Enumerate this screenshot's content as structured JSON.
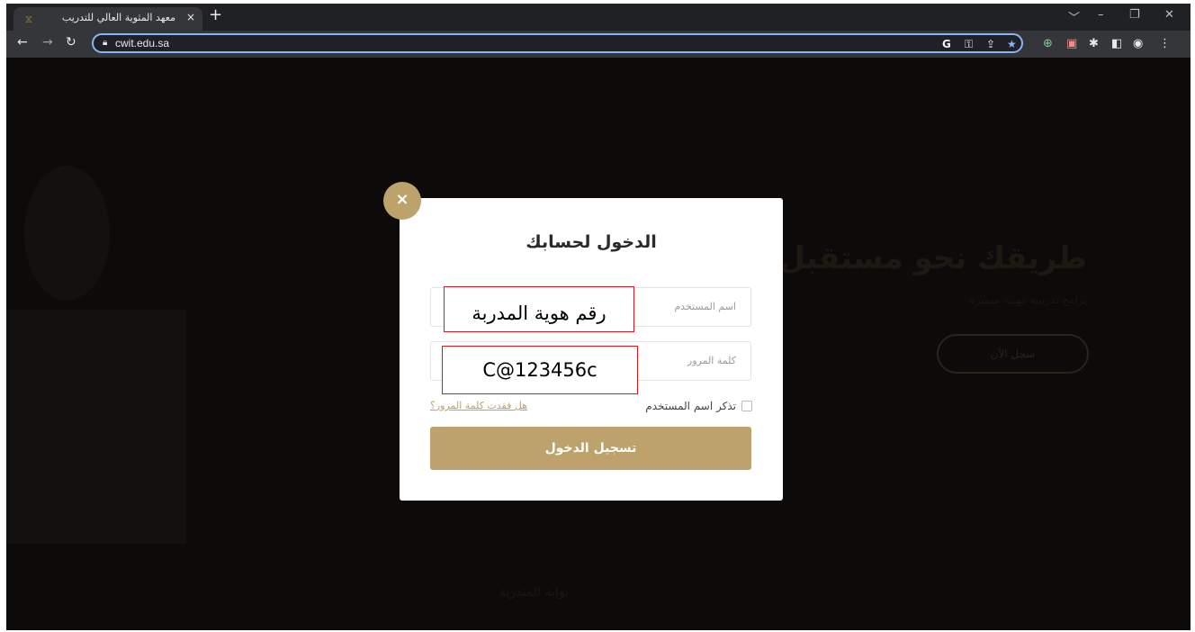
{
  "browser": {
    "tab_title": "معهد المثوية العالي للتدريب",
    "tab_close": "×",
    "new_tab": "+",
    "url": "cwit.edu.sa",
    "win_controls": [
      "﹀",
      "–",
      "❐",
      "✕"
    ]
  },
  "page": {
    "hero_title": "طريقك نحو مستقبل",
    "hero_subtitle": "برامج تدريبية مهنية متميزة",
    "hero_button": "سجل الآن",
    "section_label": "بوابة المتدربة"
  },
  "modal": {
    "close": "×",
    "title": "الدخول لحسابك",
    "username_placeholder": "اسم المستخدم",
    "password_placeholder": "كلمة المرور",
    "username_note": "رقم هوية المدربة",
    "password_note": "C@123456c",
    "remember_label": "تذكر اسم المستخدم",
    "forgot_link": "هل فقدت كلمة المرور؟",
    "login_button": "تسجيل الدخول"
  },
  "colors": {
    "accent": "#bea26b",
    "annotation": "#e0141c",
    "omnibox_focus": "#8ab4f8"
  }
}
